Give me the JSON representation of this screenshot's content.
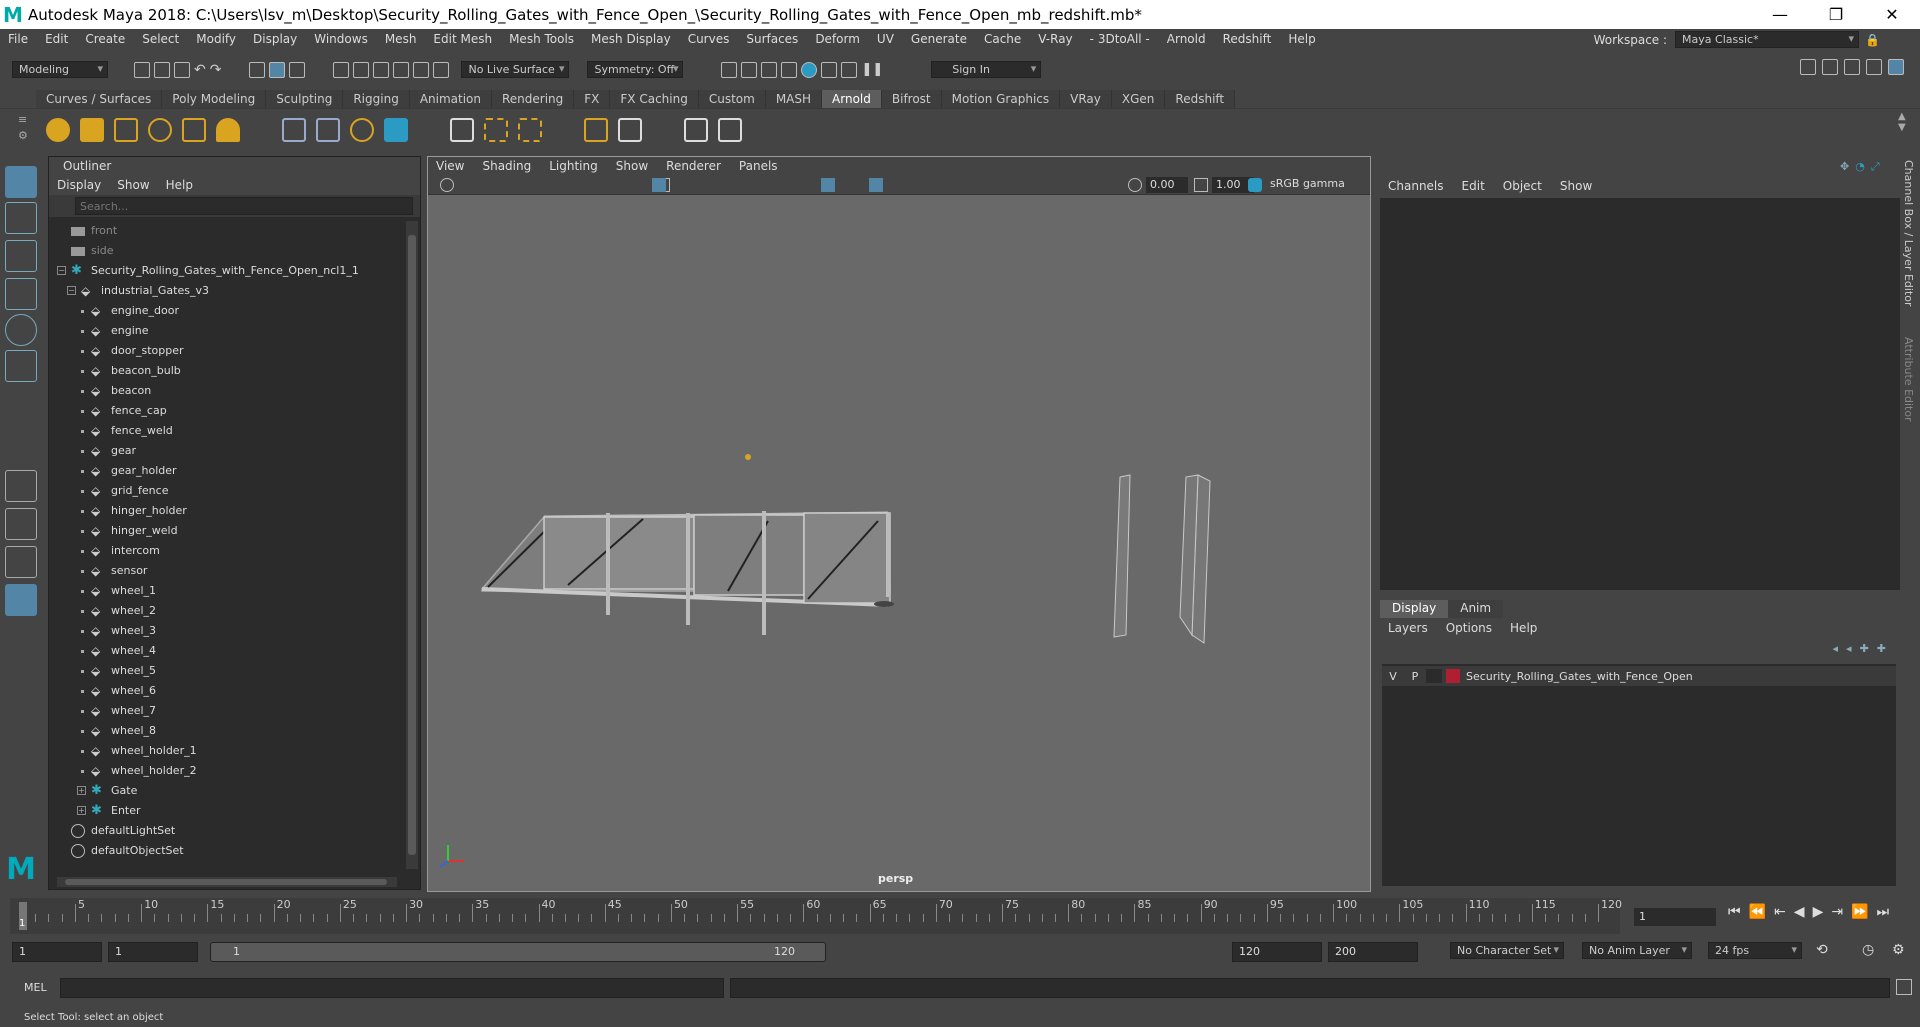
{
  "window": {
    "title": "Autodesk Maya 2018: C:\\Users\\lsv_m\\Desktop\\Security_Rolling_Gates_with_Fence_Open_\\Security_Rolling_Gates_with_Fence_Open_mb_redshift.mb*",
    "controls": [
      "—",
      "❐",
      "✕"
    ]
  },
  "menubar": [
    "File",
    "Edit",
    "Create",
    "Select",
    "Modify",
    "Display",
    "Windows",
    "Mesh",
    "Edit Mesh",
    "Mesh Tools",
    "Mesh Display",
    "Curves",
    "Surfaces",
    "Deform",
    "UV",
    "Generate",
    "Cache",
    "V-Ray",
    "- 3DtoAll -",
    "Arnold",
    "Redshift",
    "Help"
  ],
  "workspace": {
    "label": "Workspace :",
    "value": "Maya Classic*"
  },
  "statusline": {
    "mode": "Modeling",
    "live_surface": "No Live Surface",
    "symmetry": "Symmetry: Off",
    "sign_in": "Sign In"
  },
  "shelf_tabs": [
    "Curves / Surfaces",
    "Poly Modeling",
    "Sculpting",
    "Rigging",
    "Animation",
    "Rendering",
    "FX",
    "FX Caching",
    "Custom",
    "MASH",
    "Arnold",
    "Bifrost",
    "Motion Graphics",
    "VRay",
    "XGen",
    "Redshift"
  ],
  "shelf_active": "Arnold",
  "outliner": {
    "title": "Outliner",
    "menu": [
      "Display",
      "Show",
      "Help"
    ],
    "search_placeholder": "Search...",
    "items": [
      {
        "label": "front",
        "indent": 0,
        "kind": "camera",
        "dim": true
      },
      {
        "label": "side",
        "indent": 0,
        "kind": "camera",
        "dim": true
      },
      {
        "label": "Security_Rolling_Gates_with_Fence_Open_ncl1_1",
        "indent": 0,
        "kind": "group",
        "expander": "−"
      },
      {
        "label": "industrial_Gates_v3",
        "indent": 1,
        "kind": "mesh",
        "expander": "−"
      },
      {
        "label": "engine_door",
        "indent": 2,
        "kind": "mesh"
      },
      {
        "label": "engine",
        "indent": 2,
        "kind": "mesh"
      },
      {
        "label": "door_stopper",
        "indent": 2,
        "kind": "mesh"
      },
      {
        "label": "beacon_bulb",
        "indent": 2,
        "kind": "mesh"
      },
      {
        "label": "beacon",
        "indent": 2,
        "kind": "mesh"
      },
      {
        "label": "fence_cap",
        "indent": 2,
        "kind": "mesh"
      },
      {
        "label": "fence_weld",
        "indent": 2,
        "kind": "mesh"
      },
      {
        "label": "gear",
        "indent": 2,
        "kind": "mesh"
      },
      {
        "label": "gear_holder",
        "indent": 2,
        "kind": "mesh"
      },
      {
        "label": "grid_fence",
        "indent": 2,
        "kind": "mesh"
      },
      {
        "label": "hinger_holder",
        "indent": 2,
        "kind": "mesh"
      },
      {
        "label": "hinger_weld",
        "indent": 2,
        "kind": "mesh"
      },
      {
        "label": "intercom",
        "indent": 2,
        "kind": "mesh"
      },
      {
        "label": "sensor",
        "indent": 2,
        "kind": "mesh"
      },
      {
        "label": "wheel_1",
        "indent": 2,
        "kind": "mesh"
      },
      {
        "label": "wheel_2",
        "indent": 2,
        "kind": "mesh"
      },
      {
        "label": "wheel_3",
        "indent": 2,
        "kind": "mesh"
      },
      {
        "label": "wheel_4",
        "indent": 2,
        "kind": "mesh"
      },
      {
        "label": "wheel_5",
        "indent": 2,
        "kind": "mesh"
      },
      {
        "label": "wheel_6",
        "indent": 2,
        "kind": "mesh"
      },
      {
        "label": "wheel_7",
        "indent": 2,
        "kind": "mesh"
      },
      {
        "label": "wheel_8",
        "indent": 2,
        "kind": "mesh"
      },
      {
        "label": "wheel_holder_1",
        "indent": 2,
        "kind": "mesh"
      },
      {
        "label": "wheel_holder_2",
        "indent": 2,
        "kind": "mesh"
      },
      {
        "label": "Gate",
        "indent": 2,
        "kind": "group",
        "expander": "+"
      },
      {
        "label": "Enter",
        "indent": 2,
        "kind": "group",
        "expander": "+"
      },
      {
        "label": "defaultLightSet",
        "indent": 0,
        "kind": "set"
      },
      {
        "label": "defaultObjectSet",
        "indent": 0,
        "kind": "set"
      }
    ]
  },
  "viewport": {
    "menu": [
      "View",
      "Shading",
      "Lighting",
      "Show",
      "Renderer",
      "Panels"
    ],
    "exposure": "0.00",
    "gamma": "1.00",
    "color_space": "sRGB gamma",
    "camera_label": "persp"
  },
  "channel_box": {
    "menu": [
      "Channels",
      "Edit",
      "Object",
      "Show"
    ]
  },
  "layer_editor": {
    "tabs": [
      "Display",
      "Anim"
    ],
    "active_tab": "Display",
    "menu": [
      "Layers",
      "Options",
      "Help"
    ],
    "layers": [
      {
        "v": "V",
        "p": "P",
        "color": "#b01e32",
        "name": "Security_Rolling_Gates_with_Fence_Open"
      }
    ]
  },
  "side_tabs": [
    "Channel Box / Layer Editor",
    "Attribute Editor"
  ],
  "timeline": {
    "ticks": [
      "5",
      "10",
      "15",
      "20",
      "25",
      "30",
      "35",
      "40",
      "45",
      "50",
      "55",
      "60",
      "65",
      "70",
      "75",
      "80",
      "85",
      "90",
      "95",
      "100",
      "105",
      "110",
      "115",
      "120"
    ],
    "current_frame_marker": "1",
    "current_frame_field": "1"
  },
  "range": {
    "start": "1",
    "playback_start": "1",
    "slider_start": "1",
    "slider_end": "120",
    "playback_end": "120",
    "end": "200",
    "character_set": "No Character Set",
    "anim_layer": "No Anim Layer",
    "fps": "24 fps"
  },
  "mel": {
    "label": "MEL"
  },
  "help_line": "Select Tool: select an object"
}
